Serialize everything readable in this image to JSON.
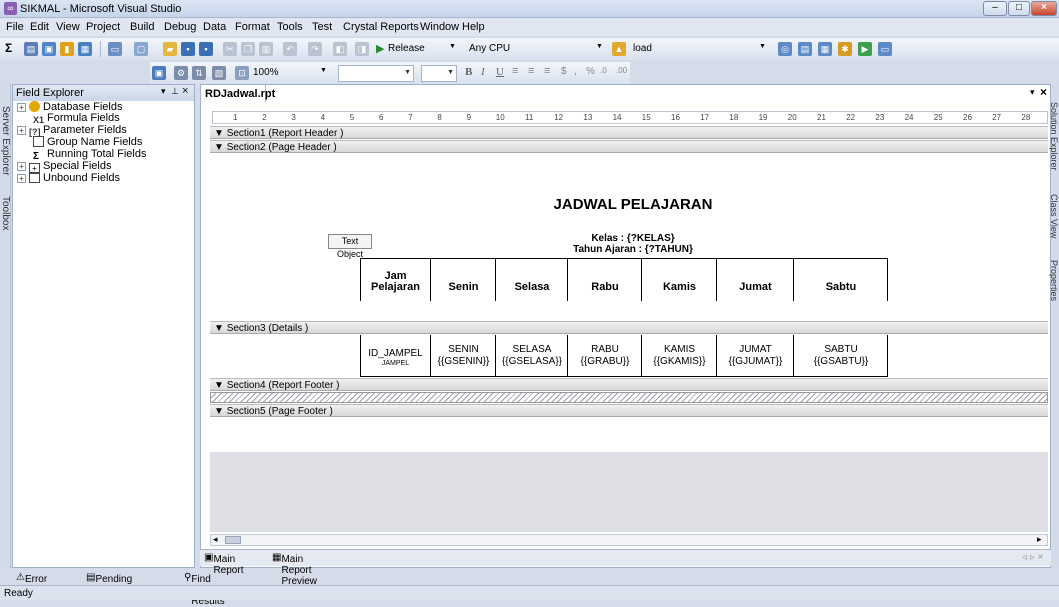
{
  "window": {
    "title": "SIKMAL - Microsoft Visual Studio"
  },
  "menu": [
    "File",
    "Edit",
    "View",
    "Project",
    "Build",
    "Debug",
    "Data",
    "Format",
    "Tools",
    "Test",
    "Crystal Reports",
    "Window",
    "Help"
  ],
  "toolbar": {
    "config": "Release",
    "platform": "Any CPU",
    "find": "load",
    "zoom": "100%",
    "format_buttons": [
      "B",
      "I",
      "U"
    ]
  },
  "left_strip": [
    "Server Explorer",
    "Toolbox"
  ],
  "right_strip": [
    "Solution Explorer",
    "Class View",
    "Properties"
  ],
  "field_explorer": {
    "title": "Field Explorer",
    "items": [
      {
        "label": "Database Fields",
        "expander": "+"
      },
      {
        "label": "Formula Fields",
        "expander": ""
      },
      {
        "label": "Parameter Fields",
        "expander": "+"
      },
      {
        "label": "Group Name Fields",
        "expander": ""
      },
      {
        "label": "Running Total Fields",
        "expander": ""
      },
      {
        "label": "Special Fields",
        "expander": "+"
      },
      {
        "label": "Unbound Fields",
        "expander": "+"
      }
    ]
  },
  "document": {
    "tab": "RDJadwal.rpt",
    "ruler_marks": [
      "1",
      "2",
      "3",
      "4",
      "5",
      "6",
      "7",
      "8",
      "9",
      "10",
      "11",
      "12",
      "13",
      "14",
      "15",
      "16",
      "17",
      "18",
      "19",
      "20",
      "21",
      "22",
      "23",
      "24",
      "25",
      "26",
      "27",
      "28"
    ],
    "sections": {
      "s1": "Section1 (Report Header )",
      "s2": "Section2 (Page Header )",
      "s3": "Section3 (Details )",
      "s4": "Section4 (Report Footer )",
      "s5": "Section5 (Page Footer )"
    },
    "report_title": "JADWAL PELAJARAN",
    "kelas": "Kelas : {?KELAS}",
    "tahun": "Tahun Ajaran : {?TAHUN}",
    "text_object": "Text Object",
    "header_cells": [
      "Jam Pelajaran",
      "Senin",
      "Selasa",
      "Rabu",
      "Kamis",
      "Jumat",
      "Sabtu"
    ],
    "detail_first": {
      "main": "ID_JAMPEL",
      "sub": "JAMPEL"
    },
    "detail_cells": [
      {
        "top": "SENIN",
        "bottom": "{{GSENIN}}"
      },
      {
        "top": "SELASA",
        "bottom": "{{GSELASA}}"
      },
      {
        "top": "RABU",
        "bottom": "{{GRABU}}"
      },
      {
        "top": "KAMIS",
        "bottom": "{{GKAMIS}}"
      },
      {
        "top": "JUMAT",
        "bottom": "{{GJUMAT}}"
      },
      {
        "top": "SABTU",
        "bottom": "{{GSABTU}}"
      }
    ],
    "bottom_tabs": [
      "Main Report",
      "Main Report Preview"
    ]
  },
  "bottom_panel_tabs": [
    "Error List",
    "Pending Checkins",
    "Find Symbol Results"
  ],
  "status": "Ready"
}
